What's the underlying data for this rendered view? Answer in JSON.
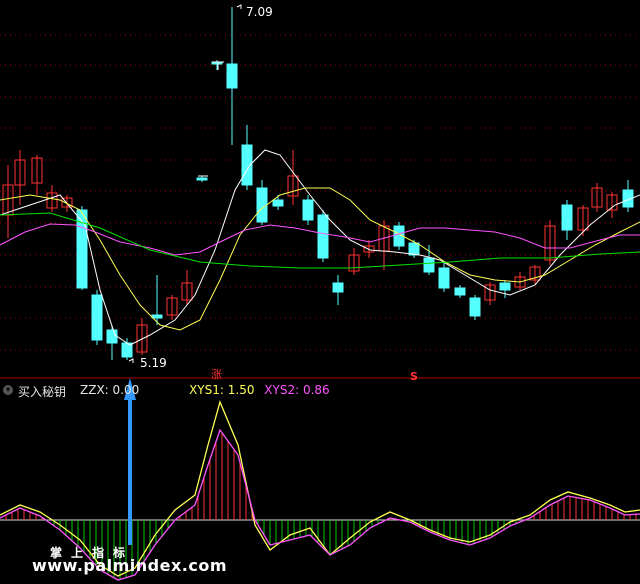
{
  "main_chart": {
    "high_label": "7.09",
    "low_label": "5.19",
    "signal_up": "涨",
    "signal_s": "S"
  },
  "indicator": {
    "name": "买入秘钥",
    "zzx_label": "ZZX: 0.00",
    "xys1_label": "XYS1: 1.50",
    "xys2_label": "XYS2: 0.86"
  },
  "watermark": {
    "cn": "掌上指标",
    "url": "www.palmindex.com"
  },
  "colors": {
    "up": "#ff3232",
    "down": "#54ffff",
    "ma_white": "#ffffff",
    "ma_yellow": "#ffff54",
    "ma_magenta": "#ff54ff",
    "ma_green": "#00e400",
    "grid": "#8b0000",
    "arrow": "#3399ff"
  }
}
